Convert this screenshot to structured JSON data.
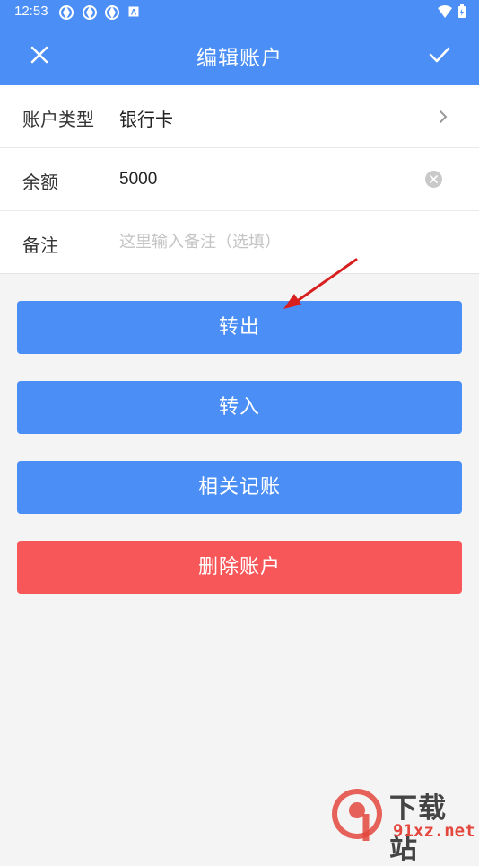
{
  "status_bar": {
    "time": "12:53",
    "icons": [
      "app-notification-icon",
      "app-notification-icon",
      "app-notification-icon",
      "a-box-icon"
    ],
    "right_icons": [
      "wifi-icon",
      "battery-icon"
    ]
  },
  "app_bar": {
    "title": "编辑账户",
    "close_icon": "close-icon",
    "confirm_icon": "check-icon",
    "color": "#4a8ef6"
  },
  "form": {
    "account_type": {
      "label": "账户类型",
      "value": "银行卡"
    },
    "balance": {
      "label": "余额",
      "value": "5000"
    },
    "note": {
      "label": "备注",
      "value": "",
      "placeholder": "这里输入备注（选填）"
    }
  },
  "actions": {
    "transfer_out": "转出",
    "transfer_in": "转入",
    "related_records": "相关记账",
    "delete_account": "删除账户"
  },
  "colors": {
    "primary": "#4a8ef6",
    "danger": "#f8575a",
    "background": "#f4f4f4"
  },
  "watermark": {
    "logo_text": "9",
    "site_name": "下载站",
    "url": "91xz.net"
  }
}
